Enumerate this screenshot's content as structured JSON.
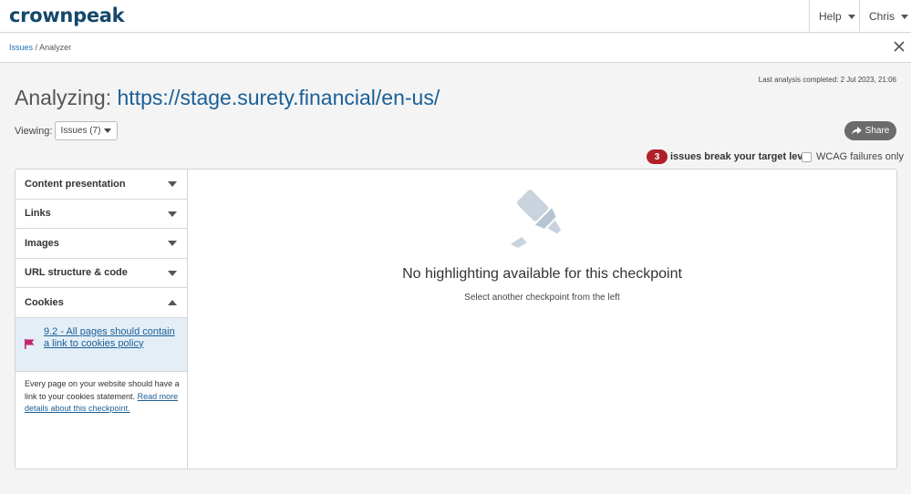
{
  "app": {
    "logo_text": "crownpeak",
    "brand_color": "#15486a",
    "accent_color": "#c1246a"
  },
  "topnav": {
    "help_label": "Help",
    "user_label": "Chris"
  },
  "breadcrumb": {
    "issues_label": "Issues",
    "separator": "/",
    "current_label": "Analyzer"
  },
  "analysis": {
    "last_completed": "Last analysis completed: 2 Jul 2023, 21:06"
  },
  "page": {
    "heading_prefix": "Analyzing: ",
    "url": "https://stage.surety.financial/en-us/"
  },
  "viewing": {
    "label": "Viewing:",
    "selected": "Issues (7)"
  },
  "share": {
    "label": "Share"
  },
  "issues_summary": {
    "count": "3",
    "text": "issues break your target level",
    "badge_color": "#b0202a"
  },
  "wcag_filter": {
    "label": "WCAG failures only",
    "checked": false
  },
  "sidebar": {
    "items": [
      {
        "label": "Content presentation",
        "expanded": false
      },
      {
        "label": "Links",
        "expanded": false
      },
      {
        "label": "Images",
        "expanded": false
      },
      {
        "label": "URL structure & code",
        "expanded": false
      },
      {
        "label": "Cookies",
        "expanded": true
      }
    ],
    "checkpoint": {
      "label": "9.2 - All pages should contain a link to cookies policy",
      "icon": "flag-icon"
    },
    "description": {
      "text": "Every page on your website should have a link to your cookies statement.",
      "link_label": "Read more details about this checkpoint."
    }
  },
  "main": {
    "icon": "highlighter-icon",
    "title": "No highlighting available for this checkpoint",
    "subtitle": "Select another checkpoint from the left"
  }
}
